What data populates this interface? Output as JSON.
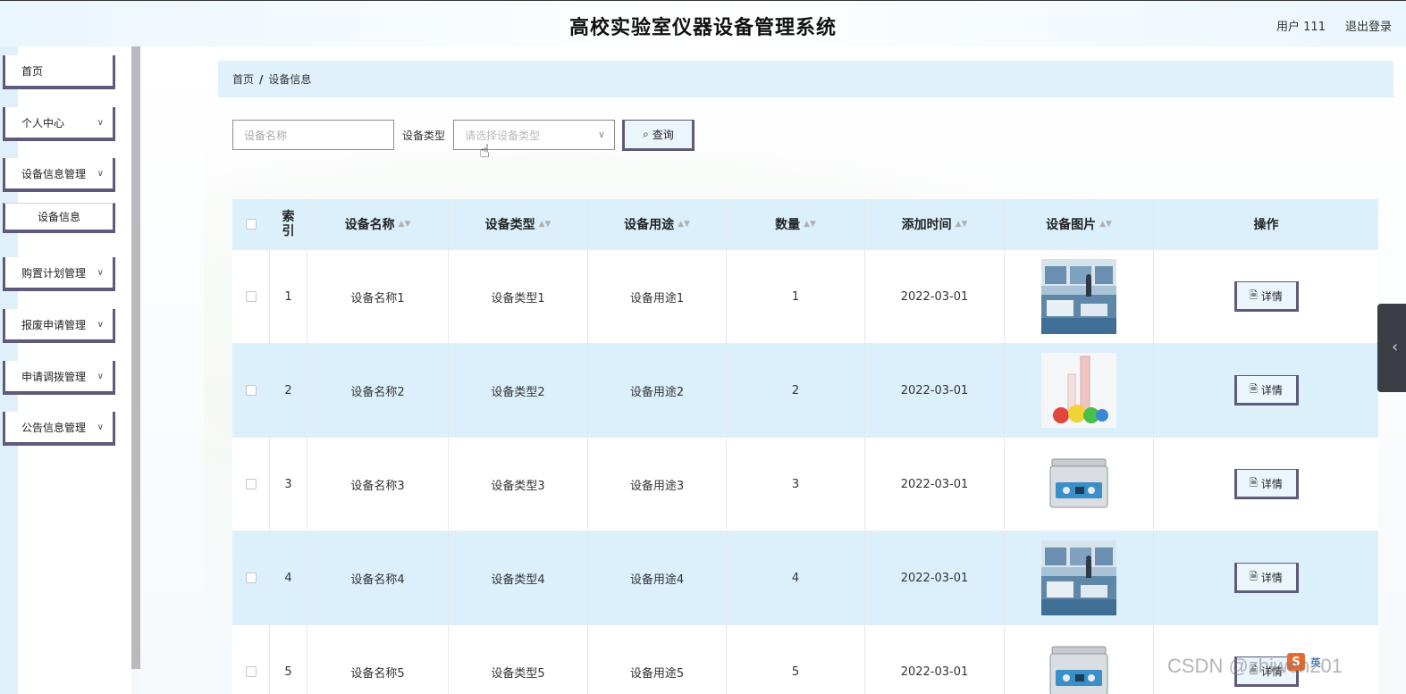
{
  "header": {
    "title": "高校实验室仪器设备管理系统",
    "user": "用户 111",
    "logout": "退出登录"
  },
  "sidebar": {
    "items": [
      {
        "label": "首页",
        "has_chevron": false
      },
      {
        "label": "个人中心",
        "has_chevron": true
      },
      {
        "label": "设备信息管理",
        "has_chevron": true
      },
      {
        "label": "设备信息",
        "sub": true
      },
      {
        "label": "购置计划管理",
        "has_chevron": true
      },
      {
        "label": "报废申请管理",
        "has_chevron": true
      },
      {
        "label": "申请调拨管理",
        "has_chevron": true
      },
      {
        "label": "公告信息管理",
        "has_chevron": true
      }
    ]
  },
  "breadcrumb": {
    "home": "首页",
    "separator": "/",
    "current": "设备信息"
  },
  "search": {
    "name_placeholder": "设备名称",
    "type_label": "设备类型",
    "type_placeholder": "请选择设备类型",
    "query_label": "查询"
  },
  "table": {
    "headers": [
      "索引",
      "设备名称",
      "设备类型",
      "设备用途",
      "数量",
      "添加时间",
      "设备图片",
      "操作"
    ],
    "detail_label": "详情",
    "rows": [
      {
        "index": "1",
        "name": "设备名称1",
        "type": "设备类型1",
        "use": "设备用途1",
        "qty": "1",
        "time": "2022-03-01",
        "image": "lab-room"
      },
      {
        "index": "2",
        "name": "设备名称2",
        "type": "设备类型2",
        "use": "设备用途2",
        "qty": "2",
        "time": "2022-03-01",
        "image": "glassware"
      },
      {
        "index": "3",
        "name": "设备名称3",
        "type": "设备类型3",
        "use": "设备用途3",
        "qty": "3",
        "time": "2022-03-01",
        "image": "ultrasonic-cleaner"
      },
      {
        "index": "4",
        "name": "设备名称4",
        "type": "设备类型4",
        "use": "设备用途4",
        "qty": "4",
        "time": "2022-03-01",
        "image": "lab-room"
      },
      {
        "index": "5",
        "name": "设备名称5",
        "type": "设备类型5",
        "use": "设备用途5",
        "qty": "5",
        "time": "2022-03-01",
        "image": "ultrasonic-cleaner"
      }
    ]
  },
  "overlay": {
    "watermark": "CSDN @zhiwen201",
    "ime_label": "英"
  },
  "colors": {
    "accent_border": "#5e5a7a",
    "light_blue": "#dcf0fb"
  }
}
